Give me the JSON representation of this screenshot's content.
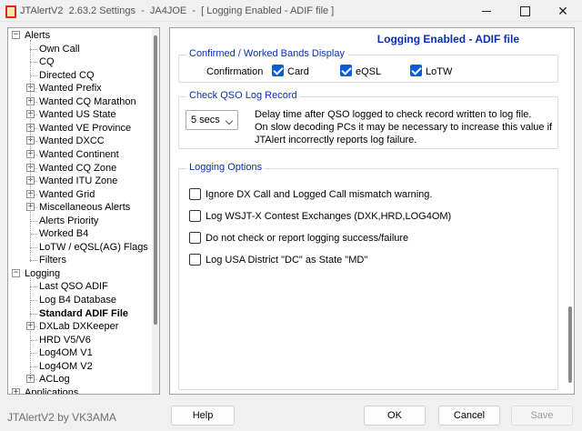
{
  "window": {
    "title": "JTAlertV2  2.63.2 Settings  -  JA4JOE  -  [ Logging Enabled - ADIF file ]"
  },
  "tree": {
    "items": [
      {
        "label": "Alerts",
        "level": 0,
        "expander": "−"
      },
      {
        "label": "Own Call",
        "level": 1
      },
      {
        "label": "CQ",
        "level": 1
      },
      {
        "label": "Directed CQ",
        "level": 1
      },
      {
        "label": "Wanted Prefix",
        "level": 1,
        "expander": "+"
      },
      {
        "label": "Wanted CQ Marathon",
        "level": 1,
        "expander": "+"
      },
      {
        "label": "Wanted US State",
        "level": 1,
        "expander": "+"
      },
      {
        "label": "Wanted VE Province",
        "level": 1,
        "expander": "+"
      },
      {
        "label": "Wanted DXCC",
        "level": 1,
        "expander": "+"
      },
      {
        "label": "Wanted Continent",
        "level": 1,
        "expander": "+"
      },
      {
        "label": "Wanted CQ Zone",
        "level": 1,
        "expander": "+"
      },
      {
        "label": "Wanted ITU Zone",
        "level": 1,
        "expander": "+"
      },
      {
        "label": "Wanted Grid",
        "level": 1,
        "expander": "+"
      },
      {
        "label": "Miscellaneous Alerts",
        "level": 1,
        "expander": "+"
      },
      {
        "label": "Alerts Priority",
        "level": 1
      },
      {
        "label": "Worked B4",
        "level": 1
      },
      {
        "label": "LoTW / eQSL(AG) Flags",
        "level": 1
      },
      {
        "label": "Filters",
        "level": 1
      },
      {
        "label": "Logging",
        "level": 0,
        "expander": "−"
      },
      {
        "label": "Last QSO ADIF",
        "level": 1
      },
      {
        "label": "Log B4 Database",
        "level": 1
      },
      {
        "label": "Standard ADIF File",
        "level": 1,
        "selected": true
      },
      {
        "label": "DXLab DXKeeper",
        "level": 1,
        "expander": "+"
      },
      {
        "label": "HRD V5/V6",
        "level": 1
      },
      {
        "label": "Log4OM V1",
        "level": 1
      },
      {
        "label": "Log4OM V2",
        "level": 1
      },
      {
        "label": "ACLog",
        "level": 1,
        "expander": "+"
      },
      {
        "label": "Applications",
        "level": 0,
        "expander": "+"
      }
    ]
  },
  "main": {
    "title": "Logging Enabled - ADIF file",
    "confirmed": {
      "legend": "Confirmed / Worked Bands Display",
      "row_label": "Confirmation",
      "options": [
        {
          "label": "Card",
          "checked": true
        },
        {
          "label": "eQSL",
          "checked": true
        },
        {
          "label": "LoTW",
          "checked": true
        }
      ]
    },
    "check_qso": {
      "legend": "Check QSO Log Record",
      "delay_value": "5 secs",
      "desc_line1": "Delay time after QSO logged to check record written to log file.",
      "desc_line2": "On slow decoding PCs it may be necessary to increase this value if",
      "desc_line3": "JTAlert incorrectly reports log failure."
    },
    "logging_options": {
      "legend": "Logging Options",
      "options": [
        {
          "label": "Ignore DX Call and Logged Call mismatch warning.",
          "checked": false
        },
        {
          "label": "Log WSJT-X Contest Exchanges (DXK,HRD,LOG4OM)",
          "checked": false
        },
        {
          "label": "Do not check or report logging success/failure",
          "checked": false
        },
        {
          "label": "Log USA District \"DC\" as State \"MD\"",
          "checked": false
        }
      ]
    }
  },
  "footer": {
    "credit": "JTAlertV2 by VK3AMA",
    "help": "Help",
    "ok": "OK",
    "cancel": "Cancel",
    "save": "Save"
  },
  "colors": {
    "accent": "#0a2fb6",
    "checkbox": "#0a5cd8"
  }
}
